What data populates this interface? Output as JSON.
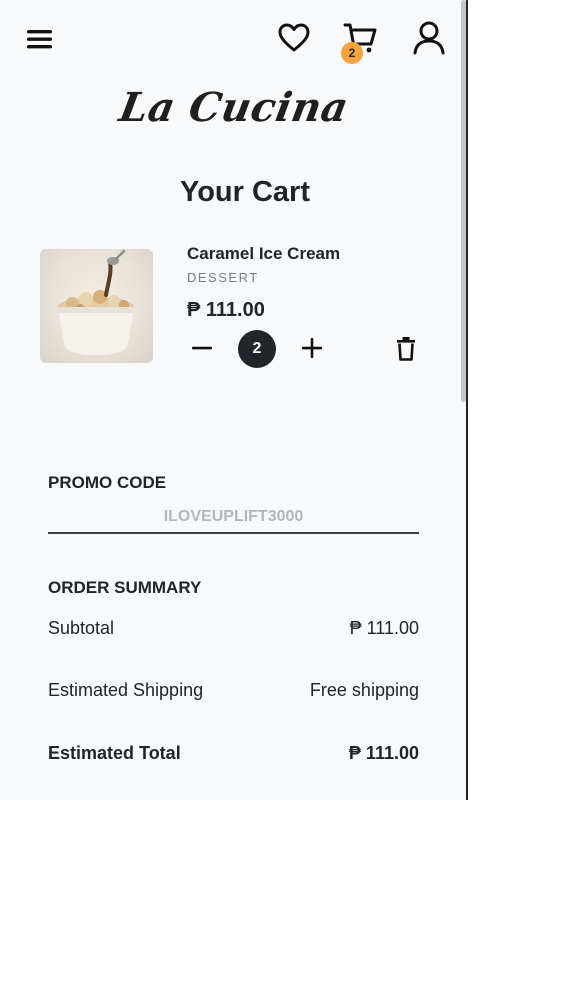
{
  "brand": {
    "name": "La Cucina"
  },
  "nav": {
    "menu_icon": "hamburger-menu-icon",
    "wishlist_icon": "heart-icon",
    "cart_icon": "cart-icon",
    "cart_count": "2",
    "account_icon": "user-icon"
  },
  "page": {
    "title": "Your Cart"
  },
  "cart": {
    "items": [
      {
        "name": "Caramel Ice Cream",
        "category": "DESSERT",
        "price": "₱ 111.00",
        "quantity": "2",
        "image_icon": "ice-cream-cup-image",
        "minus_icon": "minus-icon",
        "plus_icon": "plus-icon",
        "remove_icon": "trash-icon"
      }
    ]
  },
  "promo": {
    "heading": "PROMO CODE",
    "placeholder": "ILOVEUPLIFT3000",
    "value": ""
  },
  "summary": {
    "heading": "ORDER SUMMARY",
    "subtotal_label": "Subtotal",
    "subtotal_value": "₱ 111.00",
    "shipping_label": "Estimated Shipping",
    "shipping_value": "Free shipping",
    "total_label": "Estimated Total",
    "total_value": "₱ 111.00"
  },
  "colors": {
    "background": "#f8f9fa",
    "text": "#212529",
    "accent_badge": "#f7a440",
    "muted": "#7a7e82"
  }
}
